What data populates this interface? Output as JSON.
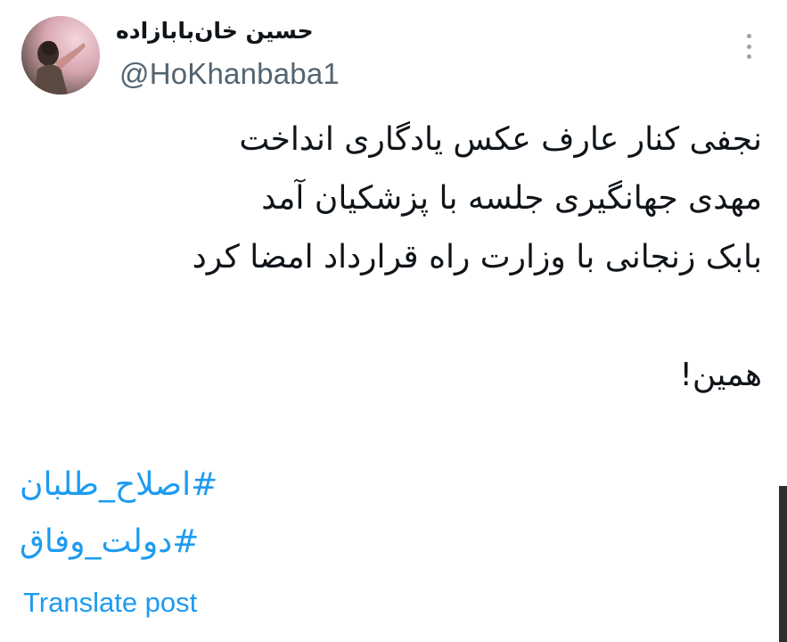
{
  "author": {
    "display_name": "حسین خان‌بابازاده",
    "handle": "@HoKhanbaba1",
    "avatar_icon": "profile-photo"
  },
  "post": {
    "lines": [
      "نجفی کنار عارف عکس یادگاری انداخت",
      "مهدی جهانگیری جلسه با پزشکیان آمد",
      "بابک زنجانی با وزارت راه قرارداد امضا کرد",
      "همین!"
    ],
    "hashtags": [
      "#اصلاح_طلبان",
      "#دولت_وفاق"
    ],
    "translate_label": "Translate post"
  },
  "colors": {
    "link": "#1d9bf0",
    "handle": "#536471",
    "text": "#0f1419"
  },
  "icons": {
    "more": "more-vertical-icon"
  }
}
